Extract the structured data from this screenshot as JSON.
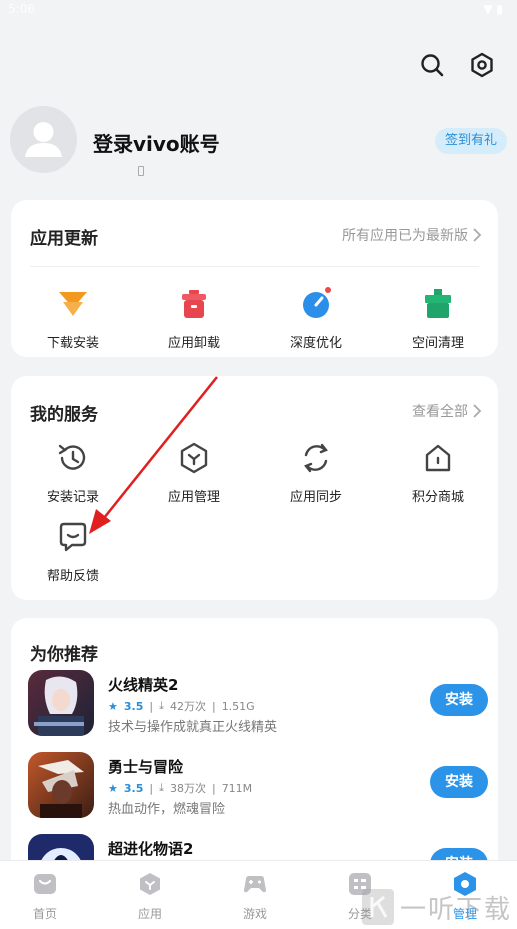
{
  "status": {
    "time": "5:06",
    "icons": "▼ ▮"
  },
  "header": {
    "icons": [
      "search-icon",
      "settings-icon"
    ]
  },
  "profile": {
    "title": "登录vivo账号",
    "badge": "签到有礼"
  },
  "updates": {
    "title": "应用更新",
    "link": "所有应用已为最新版",
    "items": [
      {
        "label": "下载安装",
        "icon": "download-icon"
      },
      {
        "label": "应用卸载",
        "icon": "uninstall-icon"
      },
      {
        "label": "深度优化",
        "icon": "optimize-icon"
      },
      {
        "label": "空间清理",
        "icon": "clean-icon"
      }
    ]
  },
  "services": {
    "title": "我的服务",
    "link": "查看全部",
    "items": [
      {
        "label": "安装记录",
        "icon": "history-icon"
      },
      {
        "label": "应用管理",
        "icon": "manage-icon"
      },
      {
        "label": "应用同步",
        "icon": "sync-icon"
      },
      {
        "label": "积分商城",
        "icon": "store-icon"
      },
      {
        "label": "帮助反馈",
        "icon": "feedback-icon"
      }
    ]
  },
  "recommend": {
    "title": "为你推荐",
    "apps": [
      {
        "name": "火线精英2",
        "rating": "3.5",
        "downloads": "42万次",
        "size": "1.51G",
        "desc": "技术与操作成就真正火线精英",
        "button": "安装"
      },
      {
        "name": "勇士与冒险",
        "rating": "3.5",
        "downloads": "38万次",
        "size": "711M",
        "desc": "热血动作，燃魂冒险",
        "button": "安装"
      },
      {
        "name": "超进化物语2",
        "rating": "",
        "downloads": "",
        "size": "",
        "desc": "",
        "button": "安装"
      }
    ]
  },
  "tabs": [
    {
      "label": "首页",
      "icon": "home-icon"
    },
    {
      "label": "应用",
      "icon": "apps-icon"
    },
    {
      "label": "游戏",
      "icon": "game-icon"
    },
    {
      "label": "分类",
      "icon": "category-icon"
    },
    {
      "label": "管理",
      "icon": "manage-tab-icon"
    }
  ],
  "watermark": "一听下载",
  "colors": {
    "accent": "#2b94e8",
    "arrow": "#e0201e",
    "badge_bg": "#d5ecfb"
  }
}
